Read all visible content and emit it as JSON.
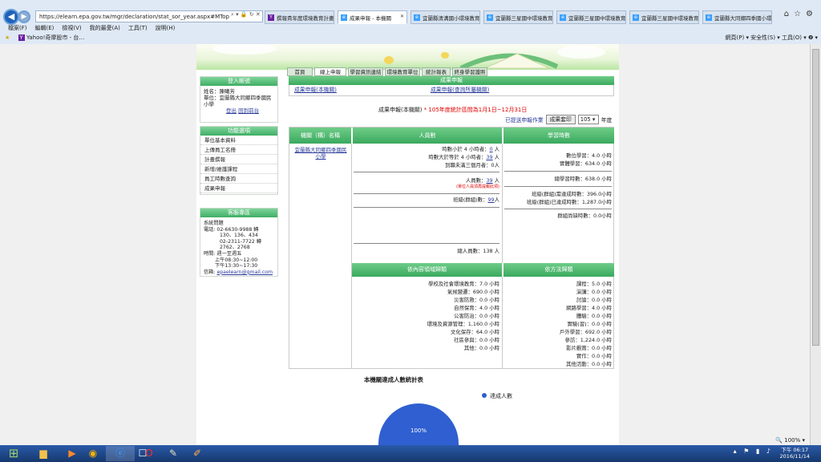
{
  "browser": {
    "url": "https://elearn.epa.gov.tw/mgr/declaration/stat_sor_year.aspx#MTop",
    "tabs": [
      {
        "label": "撰報貴年度環境教育計畫…",
        "active": false
      },
      {
        "label": "成果申報 - 本機關",
        "active": true
      },
      {
        "label": "宜蘭縣清溝國小環境教育…",
        "active": false
      },
      {
        "label": "宜蘭縣三星國中環境教育…",
        "active": false
      },
      {
        "label": "宜蘭縣三星國中環境教育…",
        "active": false
      },
      {
        "label": "宜蘭縣三星國中環境教育…",
        "active": false
      },
      {
        "label": "宜蘭縣大同鄉四季國小環…",
        "active": false
      }
    ],
    "menu": [
      "檔案(F)",
      "編輯(E)",
      "檢視(V)",
      "我的最愛(A)",
      "工具(T)",
      "說明(H)"
    ],
    "favorite": "Yahoo!奇摩股市 - 台…",
    "toolbar_right": "網頁(P) ▾   安全性(S) ▾   工具(O) ▾   ❷ ▾",
    "zoom": "100%"
  },
  "sidebar": {
    "login_title": "登入帳號",
    "name_label": "姓名：",
    "name_value": "陳曦芳",
    "unit_label": "單位：",
    "unit_value": "宜蘭縣大同鄉四季國民小學",
    "logout": "登出",
    "home": "回到前台",
    "func_title": "功能選項",
    "func_items": [
      "單位基本資料",
      "上傳員工名冊",
      "計畫撰報",
      "新增/維護課程",
      "員工時數查詢",
      "成果申報"
    ],
    "service_title": "客服專區",
    "service_lines": [
      "系統問題",
      "電話: 02-6630-9988 轉",
      "130、136、434",
      "02-2311-7722 轉",
      "2762、2768",
      "時間: 週一至週五",
      "上午08:30~12:00",
      "下午13:30~17:30"
    ],
    "email_label": "信箱:",
    "email": "epaelearn@gmail.com"
  },
  "tabs": [
    "首頁",
    "線上申報",
    "學習資訊連結",
    "環境教育單位",
    "統計報表",
    "終身學習護照"
  ],
  "report": {
    "header": "成果申報",
    "link_own": "成果申報(本機關)",
    "link_sub": "成果申報(查詢所屬機關)",
    "title": "成果申報(本機關)",
    "notice": "* 105年度統計區間為1月1日~12月31日",
    "submitted": "已提送申報作業",
    "print_button": "成果套印",
    "year": "105",
    "year_label": "年度"
  },
  "grid": {
    "col_org": "機關（構）名稱",
    "col_staff": "人員數",
    "col_hours": "學習時數",
    "org_name": "宜蘭縣大同鄉四季國民小學",
    "staff": {
      "under4_label": "時數小於 4 小時者：",
      "under4_value": "0",
      "over4_label": "時數大於等於 4 小時者：",
      "over4_value": "39",
      "under3mo_label": "到職未滿三個月者：",
      "under3mo_value": "0",
      "total_label": "人員數：",
      "total_value": "39",
      "total_note": "(單位人員須再提報此項)",
      "class_label": "班級(群組)數：",
      "class_value": "99",
      "grand_label": "總人員數：",
      "grand_value": "138 人",
      "unit": "人"
    },
    "hours": {
      "digital": "數位學習：4.0 小時",
      "physical": "實體學習：634.0 小時",
      "total": "總學習時數：638.0 小時",
      "class_assigned": "班級(群組)需達成時數：396.0小時",
      "class_done": "班級(群組)已達成時數：1,287.0小時",
      "class_missing": "群組尚缺時數：0.0小時"
    },
    "domain_title": "依內容領域歸類",
    "method_title": "依方法歸類",
    "domains": [
      {
        "label": "學校及社會環境教育：",
        "value": "7.0 小時"
      },
      {
        "label": "氣候變遷：",
        "value": "690.0 小時"
      },
      {
        "label": "災害防救：",
        "value": "0.0 小時"
      },
      {
        "label": "自然保育：",
        "value": "4.0 小時"
      },
      {
        "label": "公害防治：",
        "value": "0.0 小時"
      },
      {
        "label": "環境及資源管理：",
        "value": "1,160.0 小時"
      },
      {
        "label": "文化保存：",
        "value": "64.0 小時"
      },
      {
        "label": "社區參與：",
        "value": "0.0 小時"
      },
      {
        "label": "其他：",
        "value": "0.0 小時"
      }
    ],
    "methods": [
      {
        "label": "課程：",
        "value": "5.0 小時"
      },
      {
        "label": "演講：",
        "value": "0.0 小時"
      },
      {
        "label": "討論：",
        "value": "0.0 小時"
      },
      {
        "label": "網路學習：",
        "value": "4.0 小時"
      },
      {
        "label": "體驗：",
        "value": "0.0 小時"
      },
      {
        "label": "實驗(習)：",
        "value": "0.0 小時"
      },
      {
        "label": "戶外學習：",
        "value": "692.0 小時"
      },
      {
        "label": "參訪：",
        "value": "1,224.0 小時"
      },
      {
        "label": "影片觀賞：",
        "value": "0.0 小時"
      },
      {
        "label": "實作：",
        "value": "0.0 小時"
      },
      {
        "label": "其他活動：",
        "value": "0.0 小時"
      }
    ]
  },
  "chart_data": {
    "type": "pie",
    "title": "本機關達成人數統計表",
    "categories": [
      "達成人數"
    ],
    "values": [
      100
    ],
    "data_labels": [
      "100%"
    ],
    "colors": [
      "#2f5fd0"
    ],
    "legend": "top-right"
  },
  "taskbar": {
    "time": "下午 06:17",
    "date": "2016/11/14"
  }
}
